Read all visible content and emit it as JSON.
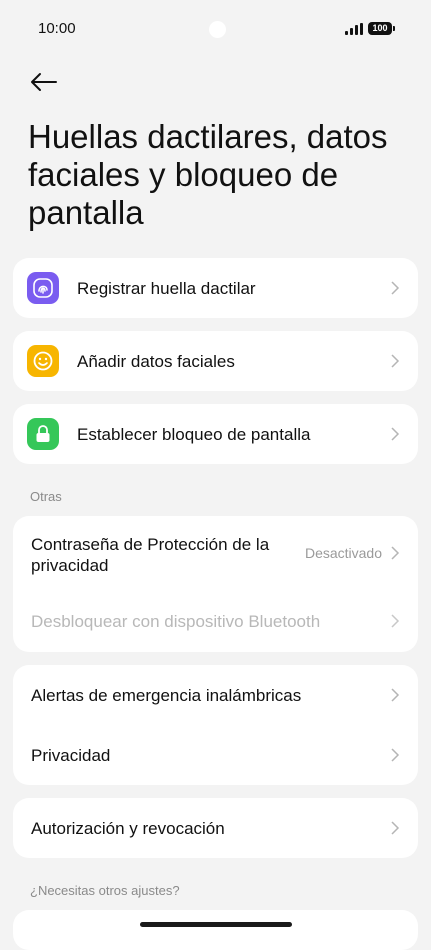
{
  "status_bar": {
    "time": "10:00",
    "battery": "100"
  },
  "header": {
    "title": "Huellas dactilares, datos faciales y bloqueo de pantalla"
  },
  "security_items": [
    {
      "label": "Registrar huella dactilar",
      "icon": "fingerprint-icon",
      "color": "#7a5cf0"
    },
    {
      "label": "Añadir datos faciales",
      "icon": "smiley-face-icon",
      "color": "#f7b500"
    },
    {
      "label": "Establecer bloqueo de pantalla",
      "icon": "padlock-icon",
      "color": "#35c759"
    }
  ],
  "others_section": {
    "label": "Otras",
    "privacy_password": {
      "label": "Contraseña de Protección de la privacidad",
      "value": "Desactivado"
    },
    "bluetooth_unlock": {
      "label": "Desbloquear con dispositivo Bluetooth"
    }
  },
  "emergency_alerts": {
    "label": "Alertas de emergencia inalámbricas"
  },
  "privacy": {
    "label": "Privacidad"
  },
  "authorization": {
    "label": "Autorización y revocación"
  },
  "more_settings": {
    "label": "¿Necesitas otros ajustes?"
  }
}
